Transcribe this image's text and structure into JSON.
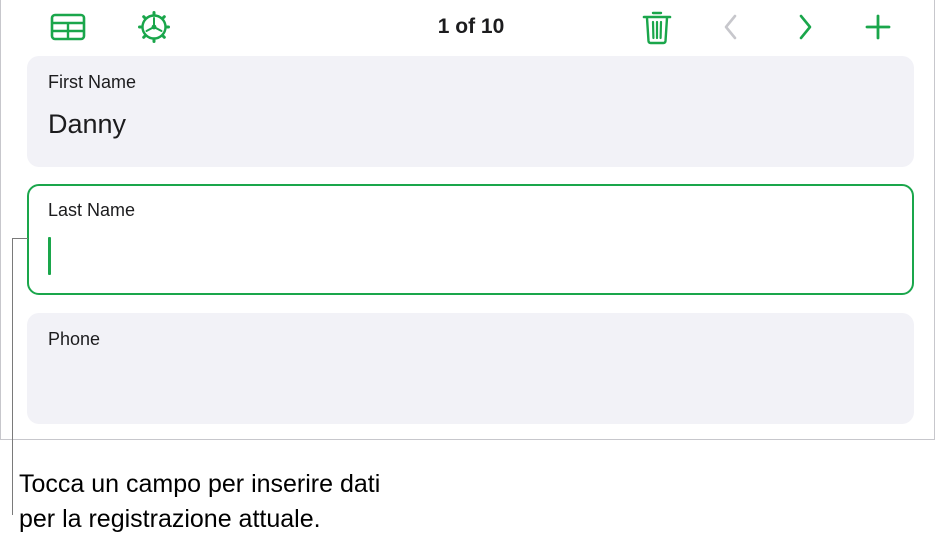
{
  "colors": {
    "accent": "#1aa64b",
    "disabled": "#c7c7cc",
    "field_bg": "#f2f2f7"
  },
  "toolbar": {
    "icons": {
      "table": "table-icon",
      "settings": "gear-icon",
      "delete": "trash-icon",
      "previous": "chevron-left-icon",
      "next": "chevron-right-icon",
      "add": "plus-icon"
    },
    "record_counter": "1 of 10",
    "previous_enabled": false
  },
  "fields": [
    {
      "label": "First Name",
      "value": "Danny",
      "active": false
    },
    {
      "label": "Last Name",
      "value": "",
      "active": true
    },
    {
      "label": "Phone",
      "value": "",
      "active": false
    }
  ],
  "callout": {
    "line1": "Tocca un campo per inserire dati",
    "line2": "per la registrazione attuale."
  }
}
